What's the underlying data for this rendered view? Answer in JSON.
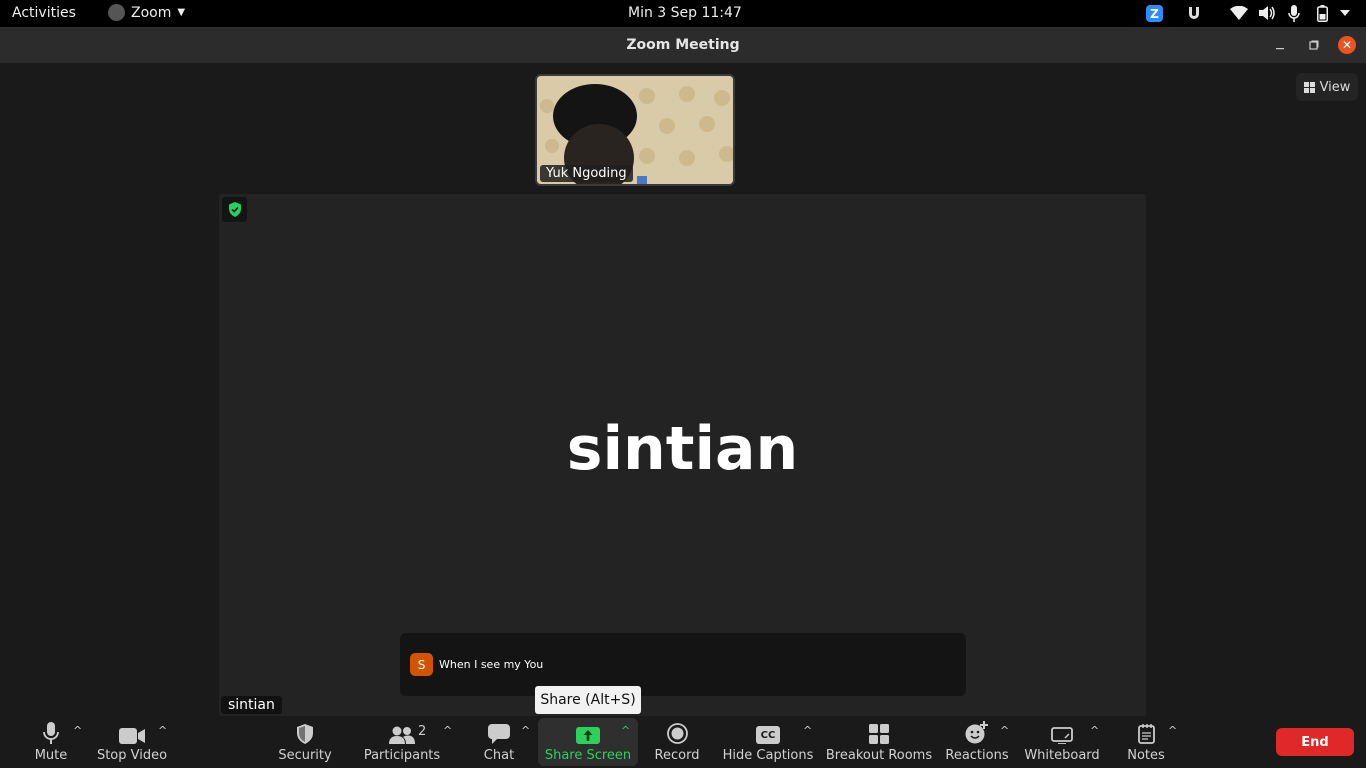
{
  "topbar": {
    "activities": "Activities",
    "app_name": "Zoom",
    "clock": "Min  3 Sep  11:47",
    "tray_zoom": "Z"
  },
  "window": {
    "title": "Zoom Meeting"
  },
  "view_button": "View",
  "thumbnail": {
    "name": "Yuk Ngoding"
  },
  "speaker": {
    "big_name": "sintian",
    "label": "sintian"
  },
  "message": {
    "avatar_letter": "S",
    "text": "When I see my You"
  },
  "tooltip": "Share (Alt+S)",
  "toolbar": {
    "mute": "Mute",
    "stop_video": "Stop Video",
    "security": "Security",
    "participants": "Participants",
    "participants_count": "2",
    "chat": "Chat",
    "share_screen": "Share Screen",
    "record": "Record",
    "hide_captions": "Hide Captions",
    "breakout_rooms": "Breakout Rooms",
    "reactions": "Reactions",
    "whiteboard": "Whiteboard",
    "notes": "Notes",
    "end": "End",
    "cc": "CC"
  },
  "colors": {
    "share_green": "#2bd15a",
    "end_red": "#e02828",
    "close_orange": "#e95420",
    "security_shield": "#23d160"
  }
}
